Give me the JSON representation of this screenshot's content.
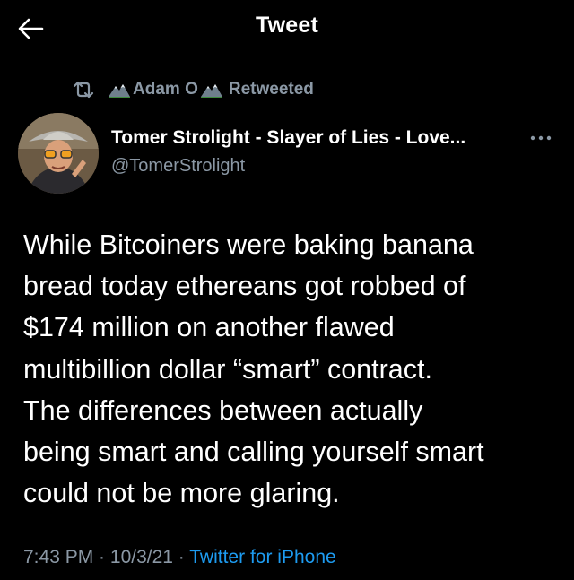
{
  "header": {
    "back_icon": "arrow-left-icon",
    "title": "Tweet"
  },
  "retweet": {
    "icon": "retweet-icon",
    "user": "Adam O",
    "user_emoji_icon": "mountain-icon",
    "text": "Retweeted"
  },
  "author": {
    "name": "Tomer Strolight - Slayer of Lies - Love...",
    "handle": "@TomerStrolight",
    "more_icon": "more-icon"
  },
  "tweet": {
    "lines": [
      "While Bitcoiners were baking banana",
      "bread today ethereans got robbed of",
      "$174 million on another flawed",
      "multibillion dollar “smart” contract.",
      "The differences between actually",
      "being smart and calling yourself smart",
      "could not be more glaring."
    ]
  },
  "meta": {
    "time": "7:43 PM",
    "sep1": " · ",
    "date": "10/3/21",
    "sep2": " · ",
    "source": "Twitter for iPhone"
  },
  "colors": {
    "background": "#000000",
    "text": "#ffffff",
    "secondary": "#8b98a5",
    "link": "#1d9bf0"
  }
}
